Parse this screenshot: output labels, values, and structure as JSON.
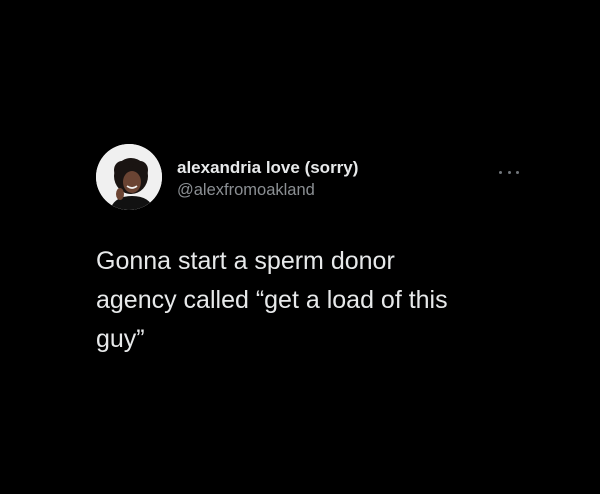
{
  "tweet": {
    "author": {
      "display_name": "alexandria love (sorry)",
      "handle": "@alexfromoakland",
      "avatar_icon": "profile-photo"
    },
    "more_icon": "ellipsis-icon",
    "text": "Gonna start a sperm donor\nagency called “get a load of this\nguy”"
  },
  "colors": {
    "background": "#000000",
    "primary_text": "#e7e9ea",
    "secondary_text": "#8b8f93"
  }
}
